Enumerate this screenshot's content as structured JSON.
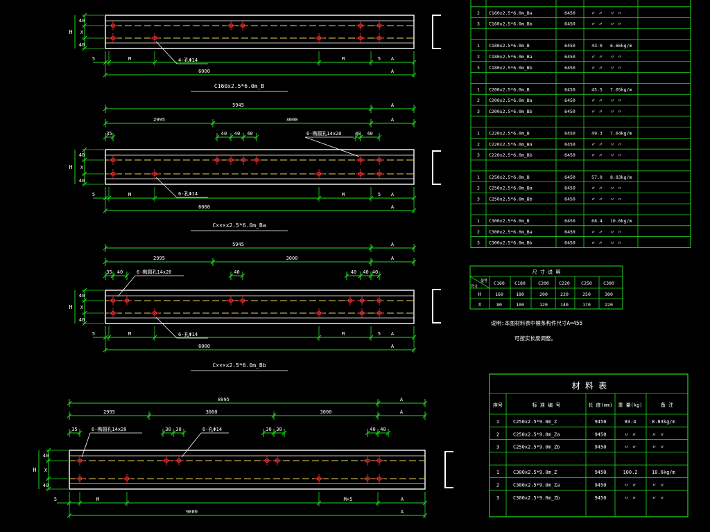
{
  "colors": {
    "background": "#000000",
    "dimension": "#22dd22",
    "outline": "#ffffff",
    "centerline": "#e8d85a",
    "hole": "#ff3333",
    "table": "#22dd22"
  },
  "beams": [
    {
      "id": "b1",
      "caption": "C160x2.5*6.0m_B",
      "dims_top": [],
      "dims_mid": [],
      "callout_top": "",
      "callout_bottom": "4-孔Φ14",
      "left_vertical": [
        "40",
        "X",
        "40"
      ],
      "left_label": "H",
      "bottom_labels": [
        "5",
        "M",
        "M",
        "5"
      ],
      "bottom_A": "A",
      "overall": "6000"
    },
    {
      "id": "b2",
      "caption": "C×××x2.5*6.0m_Ba",
      "dims_top": [
        "5945",
        "A"
      ],
      "dims_mid": [
        "2995",
        "3000",
        "A"
      ],
      "small_dims": [
        "35",
        "40",
        "40",
        "40",
        "40",
        "40"
      ],
      "callout_top": "6-椭圆孔14x20",
      "callout_bottom": "6-孔Φ14",
      "left_vertical": [
        "40",
        "X",
        "40"
      ],
      "left_label": "H",
      "bottom_labels": [
        "5",
        "M",
        "M",
        "5"
      ],
      "bottom_A": "A",
      "overall": "6000"
    },
    {
      "id": "b3",
      "caption": "C×××x2.5*6.0m_Bb",
      "dims_top": [
        "5945",
        "A"
      ],
      "dims_mid": [
        "2995",
        "3000",
        "A"
      ],
      "small_dims": [
        "35",
        "40",
        "40",
        "40",
        "40",
        "40"
      ],
      "callout_top": "6-椭圆孔14x20",
      "callout_bottom": "6-孔Φ14",
      "left_vertical": [
        "40",
        "X",
        "40"
      ],
      "left_label": "H",
      "bottom_labels": [
        "5",
        "M",
        "M",
        "5"
      ],
      "bottom_A": "A",
      "overall": "6000"
    },
    {
      "id": "b4",
      "caption": "",
      "dims_top": [
        "8995",
        "A"
      ],
      "dims_mid": [
        "2995",
        "3000",
        "3000",
        "A"
      ],
      "small_dims": [
        "35",
        "30",
        "30",
        "30",
        "30",
        "40",
        "40"
      ],
      "callout_top": "6-椭圆孔14x20",
      "callout_mid": "6-孔Φ14",
      "left_vertical": [
        "40",
        "X",
        "40"
      ],
      "left_label": "H",
      "bottom_labels": [
        "5",
        "M",
        "M+5"
      ],
      "bottom_A": "A",
      "overall": "9000"
    }
  ],
  "table1": {
    "rows": [
      [
        "2",
        "C160x2.5*6.0m_Ba",
        "6450",
        "〃 〃",
        "〃 〃"
      ],
      [
        "3",
        "C160x2.5*6.0m_Bb",
        "6450",
        "〃 〃",
        "〃 〃"
      ],
      [
        "",
        "",
        "",
        "",
        ""
      ],
      [
        "1",
        "C180x2.5*6.0m_B",
        "6450",
        "43.0",
        "6.66kg/m"
      ],
      [
        "2",
        "C180x2.5*6.0m_Ba",
        "6450",
        "〃 〃",
        "〃 〃"
      ],
      [
        "3",
        "C180x2.5*6.0m_Bb",
        "6450",
        "〃 〃",
        "〃 〃"
      ],
      [
        "",
        "",
        "",
        "",
        ""
      ],
      [
        "1",
        "C200x2.5*6.0m_B",
        "6450",
        "45.5",
        "7.05kg/m"
      ],
      [
        "2",
        "C200x2.5*6.0m_Ba",
        "6450",
        "〃 〃",
        "〃 〃"
      ],
      [
        "3",
        "C200x2.5*6.0m_Bb",
        "6450",
        "〃 〃",
        "〃 〃"
      ],
      [
        "",
        "",
        "",
        "",
        ""
      ],
      [
        "1",
        "C220x2.5*6.0m_B",
        "6450",
        "49.3",
        "7.64kg/m"
      ],
      [
        "2",
        "C220x2.5*6.0m_Ba",
        "6450",
        "〃 〃",
        "〃 〃"
      ],
      [
        "3",
        "C220x2.5*6.0m_Bb",
        "6450",
        "〃 〃",
        "〃 〃"
      ],
      [
        "",
        "",
        "",
        "",
        ""
      ],
      [
        "1",
        "C250x2.5*6.0m_B",
        "6450",
        "57.0",
        "8.83kg/m"
      ],
      [
        "2",
        "C250x2.5*6.0m_Ba",
        "6450",
        "〃 〃",
        "〃 〃"
      ],
      [
        "3",
        "C250x2.5*6.0m_Bb",
        "6450",
        "〃 〃",
        "〃 〃"
      ],
      [
        "",
        "",
        "",
        "",
        ""
      ],
      [
        "1",
        "C300x2.5*6.0m_B",
        "6450",
        "68.4",
        "10.6kg/m"
      ],
      [
        "2",
        "C300x2.5*6.0m_Ba",
        "6450",
        "〃 〃",
        "〃 〃"
      ],
      [
        "3",
        "C300x2.5*6.0m_Bb",
        "6450",
        "〃 〃",
        "〃 〃"
      ]
    ]
  },
  "dim_table": {
    "title": "尺 寸 说 明",
    "corner_top": "型号",
    "corner_bottom": "尺寸",
    "headers": [
      "C160",
      "C180",
      "C200",
      "C220",
      "C250",
      "C300"
    ],
    "rows": [
      {
        "label": "H",
        "values": [
          "160",
          "180",
          "200",
          "220",
          "250",
          "300"
        ]
      },
      {
        "label": "X",
        "values": [
          "80",
          "100",
          "120",
          "140",
          "170",
          "220"
        ]
      }
    ],
    "note1": "说明:本图材料表中檩条构件尺寸A=455",
    "note2": "可按实长度调整。"
  },
  "material_table": {
    "title": "材 料 表",
    "headers": [
      "序号",
      "标 准 编 号",
      "长 度(mm)",
      "重 量(kg)",
      "备 注"
    ],
    "rows": [
      [
        "1",
        "C250x2.5*9.0m_Z",
        "9450",
        "83.4",
        "8.83kg/m"
      ],
      [
        "2",
        "C250x2.5*9.0m_Za",
        "9450",
        "〃 〃",
        "〃 〃"
      ],
      [
        "3",
        "C250x2.5*9.0m_Zb",
        "9450",
        "〃 〃",
        "〃 〃"
      ],
      [
        "",
        "",
        "",
        "",
        ""
      ],
      [
        "1",
        "C300x2.5*9.0m_Z",
        "9450",
        "100.2",
        "10.6kg/m"
      ],
      [
        "2",
        "C300x2.5*9.0m_Za",
        "9450",
        "〃 〃",
        "〃 〃"
      ],
      [
        "3",
        "C300x2.5*9.0m_Zb",
        "9450",
        "〃 〃",
        "〃 〃"
      ]
    ]
  }
}
